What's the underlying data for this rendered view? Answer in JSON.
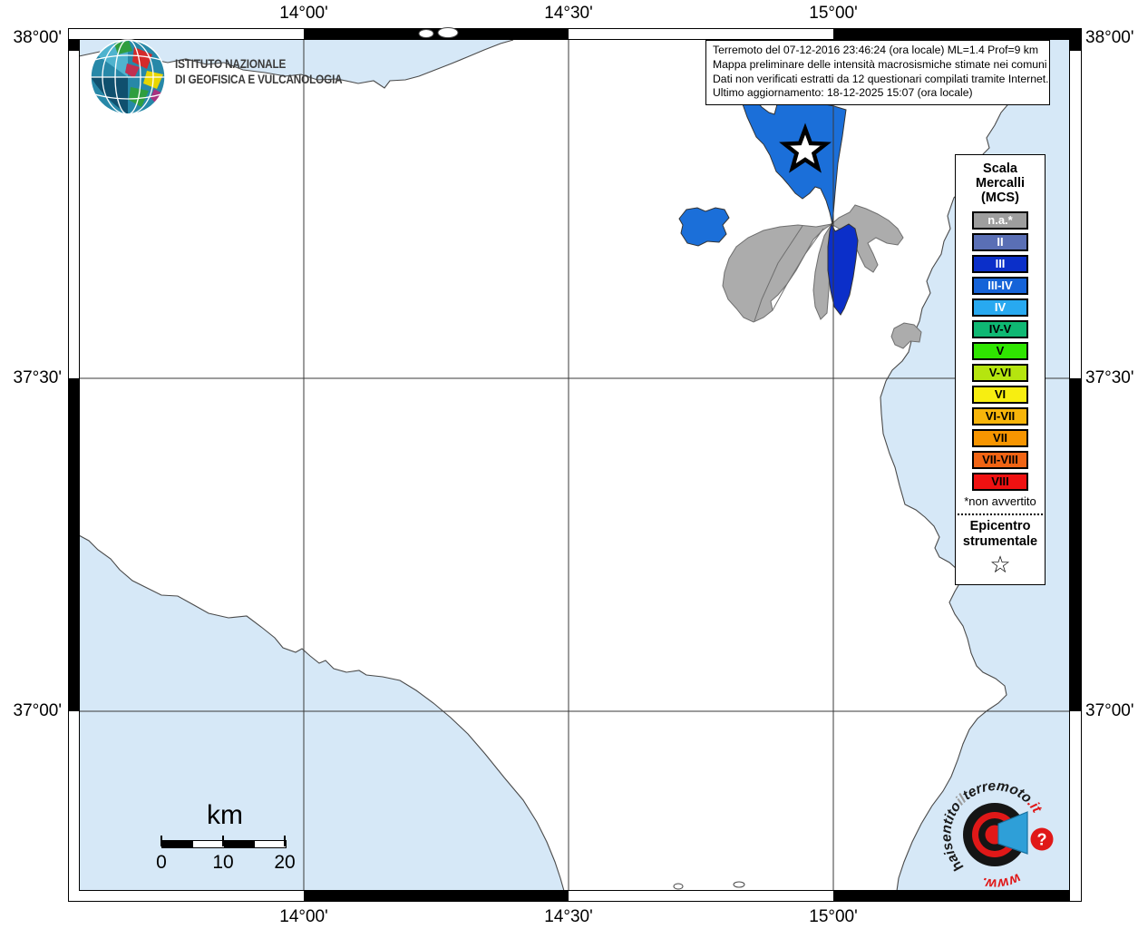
{
  "map": {
    "lon_labels": [
      "14°00'",
      "14°30'",
      "15°00'"
    ],
    "lat_labels": [
      "38°00'",
      "37°30'",
      "37°00'"
    ],
    "colors": {
      "sea": "#D6E8F7",
      "land": "#FFFFFF",
      "mun_na": "#ACACAC",
      "mun_iii": "#0B2FC9",
      "mun_iii_iv": "#1B6FD9",
      "grid": "#3A3A3A"
    }
  },
  "info_box": {
    "lines": [
      "Terremoto del 07-12-2016 23:46:24 (ora locale) ML=1.4 Prof=9 km",
      "Mappa preliminare delle intensità macrosismiche stimate nei comuni",
      "Dati non verificati estratti da 12 questionari compilati tramite Internet.",
      "Ultimo aggiornamento: 18-12-2025 15:07 (ora locale)"
    ]
  },
  "legend": {
    "title_lines": [
      "Scala",
      "Mercalli",
      "(MCS)"
    ],
    "items": [
      {
        "label": "n.a.*",
        "color": "#9E9E9E",
        "text": "#FFFFFF"
      },
      {
        "label": "II",
        "color": "#5A6FB5",
        "text": "#FFFFFF"
      },
      {
        "label": "III",
        "color": "#0B2FC9",
        "text": "#FFFFFF"
      },
      {
        "label": "III-IV",
        "color": "#1563D8",
        "text": "#FFFFFF"
      },
      {
        "label": "IV",
        "color": "#28A9F0",
        "text": "#FFFFFF"
      },
      {
        "label": "IV-V",
        "color": "#0FB873",
        "text": "#000000"
      },
      {
        "label": "V",
        "color": "#2FE500",
        "text": "#000000"
      },
      {
        "label": "V-VI",
        "color": "#B5E50F",
        "text": "#000000"
      },
      {
        "label": "VI",
        "color": "#F7EE11",
        "text": "#000000"
      },
      {
        "label": "VI-VII",
        "color": "#F7B50A",
        "text": "#000000"
      },
      {
        "label": "VII",
        "color": "#F79500",
        "text": "#000000"
      },
      {
        "label": "VII-VIII",
        "color": "#F06414",
        "text": "#000000"
      },
      {
        "label": "VIII",
        "color": "#F01111",
        "text": "#000000"
      }
    ],
    "footnote": "*non avvertito",
    "epicenter_title_lines": [
      "Epicentro",
      "strumentale"
    ],
    "epicenter_symbol": "☆"
  },
  "scale_bar": {
    "title": "km",
    "labels": [
      "0",
      "10",
      "20"
    ]
  },
  "ingv_logo": {
    "line1": "ISTITUTO NAZIONALE",
    "line2": "DI GEOFISICA E VULCANOLOGIA"
  },
  "hst_logo": {
    "www": "www.",
    "part1": "haisentito",
    "part2": "il",
    "part3": "terremoto",
    "part4": ".it",
    "question_mark": "?"
  }
}
